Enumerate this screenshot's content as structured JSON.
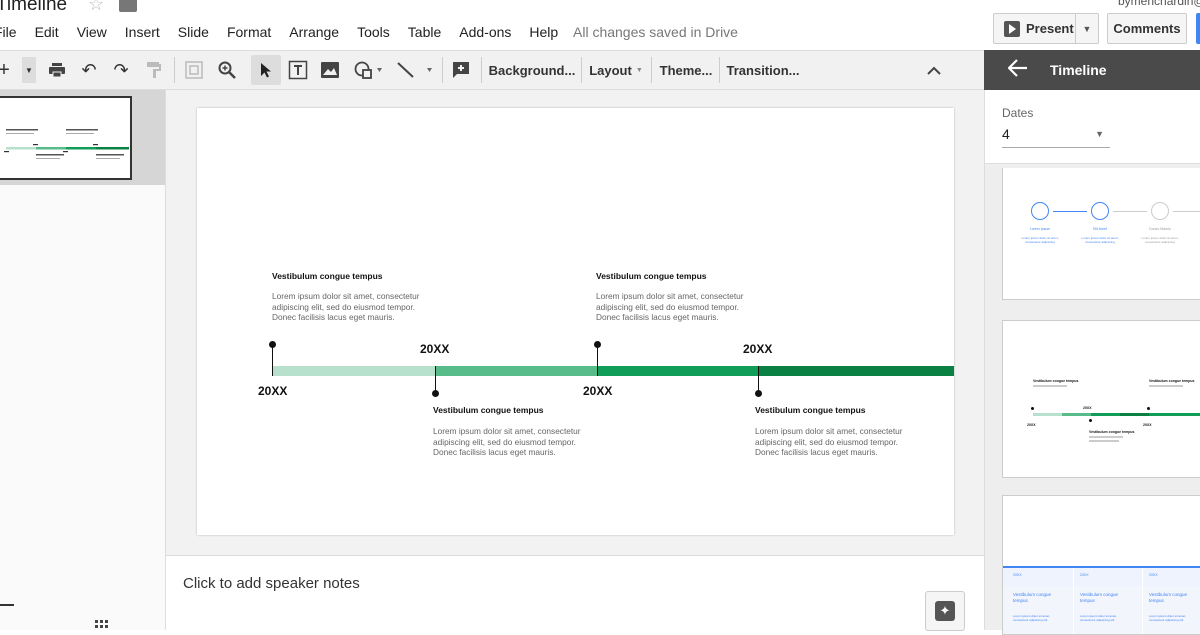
{
  "header": {
    "doc_title": "Timeline",
    "user_email": "bymenchardin@",
    "menu": [
      "File",
      "Edit",
      "View",
      "Insert",
      "Slide",
      "Format",
      "Arrange",
      "Tools",
      "Table",
      "Add-ons",
      "Help"
    ],
    "save_status": "All changes saved in Drive",
    "present_label": "Present",
    "comments_label": "Comments"
  },
  "toolbar": {
    "background_label": "Background...",
    "layout_label": "Layout",
    "theme_label": "Theme...",
    "transition_label": "Transition..."
  },
  "panel": {
    "title": "Timeline",
    "dates_label": "Dates",
    "dates_value": "4",
    "preview1": {
      "steps": [
        {
          "title": "Lorem Ipsum",
          "desc": "Lorem ipsum dolor sit amet, consectetur adipiscing"
        },
        {
          "title": "Elit Amet",
          "desc": "Lorem ipsum dolor sit amet, consectetur adipiscing"
        },
        {
          "title": "Donec Mauris",
          "desc": "Lorem ipsum dolor sit amet, consectetur adipiscing"
        }
      ]
    },
    "preview2": {
      "title_a": "Vestibulum congue tempus",
      "title_b": "Vestibulum congue tempus",
      "title_c": "Vestibulum congue tempus",
      "year": "20XX"
    },
    "preview3": {
      "year": "20XX",
      "title_a": "Vestibulum congue tempus",
      "title_b": "Vestibulum congue tempus",
      "title_c": "Vestibulum congue tempus",
      "body": "Lorem ipsum dolor sit amet, consectetur adipiscing elit"
    }
  },
  "slide": {
    "blocks": [
      {
        "title": "Vestibulum congue tempus",
        "body": "Lorem ipsum dolor sit amet, consectetur adipiscing elit, sed do eiusmod tempor. Donec facilisis lacus eget mauris."
      },
      {
        "title": "Vestibulum congue tempus",
        "body": "Lorem ipsum dolor sit amet, consectetur adipiscing elit, sed do eiusmod tempor. Donec facilisis lacus eget mauris."
      },
      {
        "title": "Vestibulum congue tempus",
        "body": "Lorem ipsum dolor sit amet, consectetur adipiscing elit, sed do eiusmod tempor. Donec facilisis lacus eget mauris."
      },
      {
        "title": "Vestibulum congue tempus",
        "body": "Lorem ipsum dolor sit amet, consectetur adipiscing elit, sed do eiusmod tempor. Donec facilisis lacus eget mauris."
      }
    ],
    "year_labels": [
      "20XX",
      "20XX",
      "20XX",
      "20XX"
    ],
    "segment_colors": [
      "#b7e1cd",
      "#57bb8a",
      "#0f9d58",
      "#0b8043"
    ]
  },
  "notes": {
    "placeholder": "Click to add speaker notes"
  }
}
